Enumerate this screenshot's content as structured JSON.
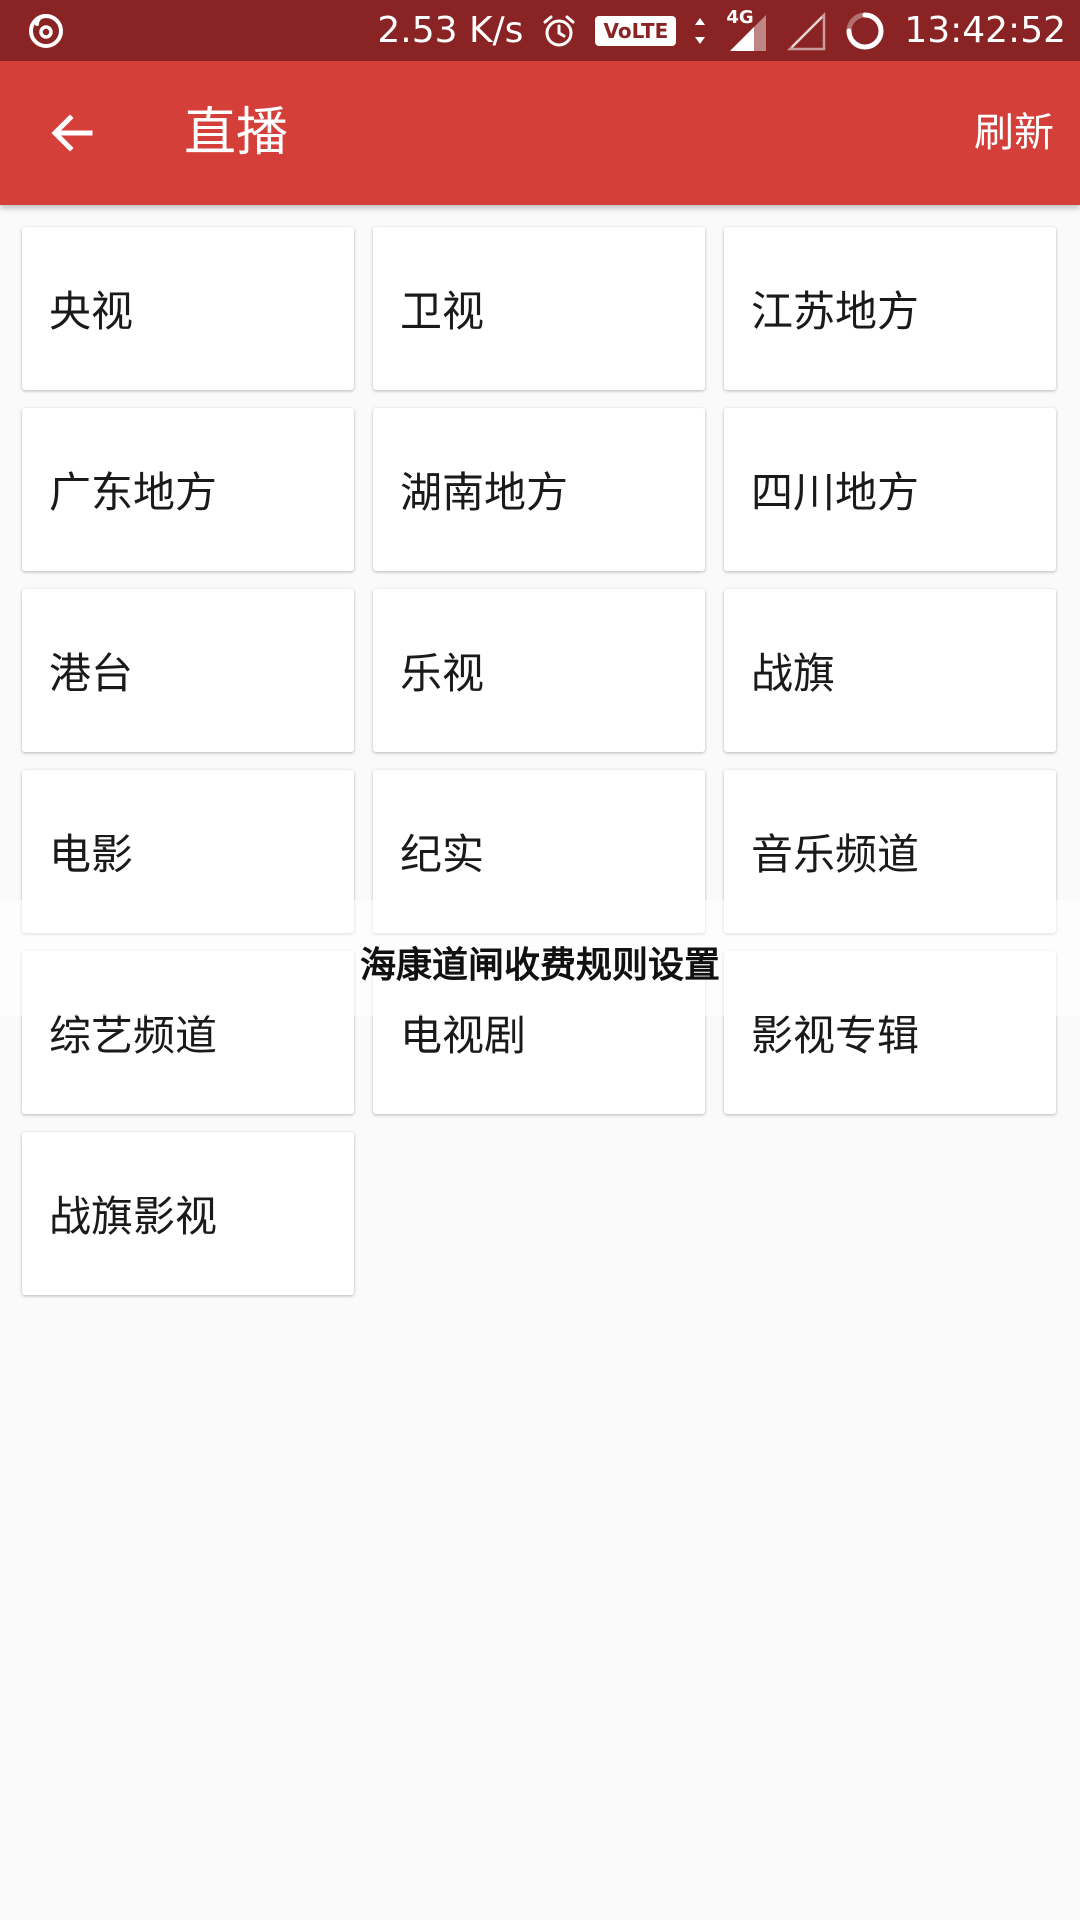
{
  "status_bar": {
    "net_speed": "2.53 K/s",
    "volte": "VoLTE",
    "network": "4G",
    "time": "13:42:52",
    "icons": [
      "netease-music-icon",
      "alarm-icon",
      "volte-icon",
      "data-arrows-icon",
      "signal-4g-icon",
      "signal-empty-icon",
      "loading-ring-icon"
    ]
  },
  "app_bar": {
    "back_icon": "arrow-back-icon",
    "title": "直播",
    "refresh_label": "刷新",
    "color": "#d43f3a"
  },
  "channels": [
    {
      "label": "央视"
    },
    {
      "label": "卫视"
    },
    {
      "label": "江苏地方"
    },
    {
      "label": "广东地方"
    },
    {
      "label": "湖南地方"
    },
    {
      "label": "四川地方"
    },
    {
      "label": "港台"
    },
    {
      "label": "乐视"
    },
    {
      "label": "战旗"
    },
    {
      "label": "电影"
    },
    {
      "label": "纪实"
    },
    {
      "label": "音乐频道"
    },
    {
      "label": "综艺频道"
    },
    {
      "label": "电视剧"
    },
    {
      "label": "影视专辑"
    },
    {
      "label": "战旗影视"
    }
  ],
  "overlay": {
    "watermark": "海康道闸收费规则设置"
  }
}
